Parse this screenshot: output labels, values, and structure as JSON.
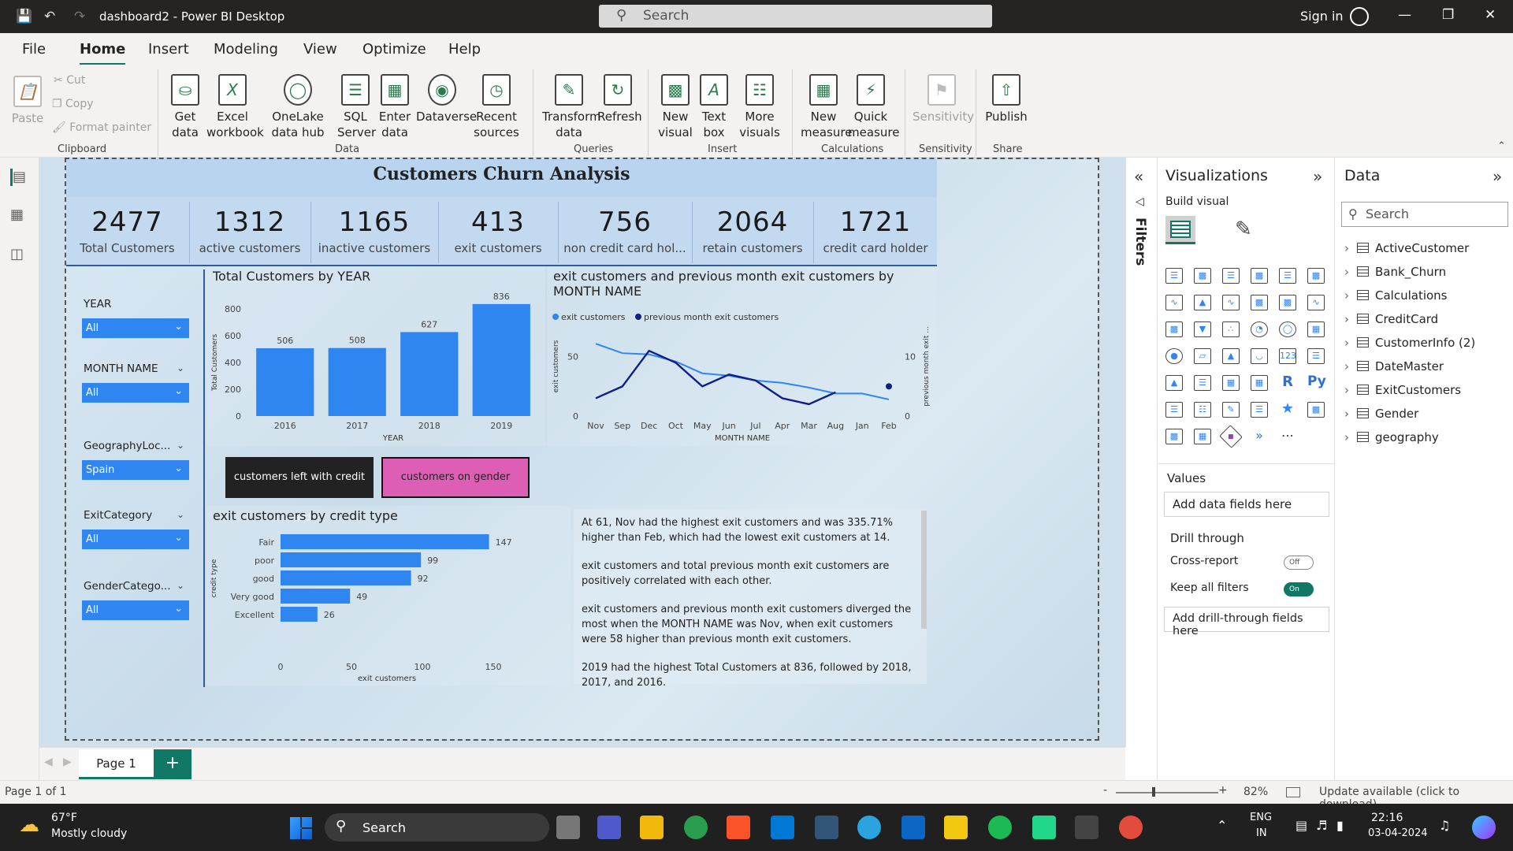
{
  "app": {
    "title": "dashboard2 - Power BI Desktop",
    "search": "Search",
    "signin": "Sign in"
  },
  "menu": [
    "File",
    "Home",
    "Insert",
    "Modeling",
    "View",
    "Optimize",
    "Help"
  ],
  "ribbon": {
    "clipboard": {
      "paste": "Paste",
      "cut": "Cut",
      "copy": "Copy",
      "format_painter": "Format painter",
      "group": "Clipboard"
    },
    "data": {
      "get_data": "Get data",
      "excel": "Excel workbook",
      "onelake": "OneLake data hub",
      "sql": "SQL Server",
      "enter": "Enter data",
      "dataverse": "Dataverse",
      "recent": "Recent sources",
      "group": "Data"
    },
    "queries": {
      "transform": "Transform data",
      "refresh": "Refresh",
      "group": "Queries"
    },
    "insert": {
      "new_visual": "New visual",
      "text_box": "Text box",
      "more_visuals": "More visuals",
      "group": "Insert"
    },
    "calc": {
      "new_measure": "New measure",
      "quick_measure": "Quick measure",
      "group": "Calculations"
    },
    "sensitivity": {
      "label": "Sensitivity",
      "group": "Sensitivity"
    },
    "share": {
      "publish": "Publish",
      "group": "Share"
    }
  },
  "report": {
    "title": "Customers Churn Analysis",
    "kpis": [
      {
        "value": "2477",
        "label": "Total Customers"
      },
      {
        "value": "1312",
        "label": "active customers"
      },
      {
        "value": "1165",
        "label": "inactive customers"
      },
      {
        "value": "413",
        "label": "exit customers"
      },
      {
        "value": "756",
        "label": "non credit card hol..."
      },
      {
        "value": "2064",
        "label": "retain customers"
      },
      {
        "value": "1721",
        "label": "credit card holder"
      }
    ],
    "slicers": [
      {
        "label": "YEAR",
        "value": "All"
      },
      {
        "label": "MONTH NAME",
        "value": "All"
      },
      {
        "label": "GeographyLoc...",
        "value": "Spain"
      },
      {
        "label": "ExitCategory",
        "value": "All"
      },
      {
        "label": "GenderCatego...",
        "value": "All"
      }
    ],
    "buttons": {
      "credit": "customers left with credit card",
      "gender": "customers on gender"
    },
    "narrative": {
      "p1": "At 61, Nov had the highest exit customers and was 335.71% higher than Feb, which had the lowest exit customers at 14.",
      "p2": "exit customers and total previous month exit customers are positively correlated with each other.",
      "p3": "exit customers and previous month exit customers diverged the most when the MONTH NAME was Nov, when exit customers were 58 higher than previous month exit customers.",
      "p4": "2019 had the highest Total Customers at 836, followed by 2018, 2017, and 2016."
    }
  },
  "chart_data": [
    {
      "type": "bar",
      "title": "Total Customers by YEAR",
      "xlabel": "YEAR",
      "ylabel": "Total Customers",
      "categories": [
        "2016",
        "2017",
        "2018",
        "2019"
      ],
      "values": [
        506,
        508,
        627,
        836
      ],
      "ylim": [
        0,
        800
      ],
      "yticks": [
        "0",
        "200",
        "400",
        "600",
        "800"
      ],
      "color": "#2f86f0"
    },
    {
      "type": "line",
      "title": "exit customers and previous month exit customers by MONTH NAME",
      "xlabel": "MONTH NAME",
      "ylabel": "exit customers",
      "y2label": "previous month exit ...",
      "categories": [
        "Nov",
        "Sep",
        "Dec",
        "Oct",
        "May",
        "Jun",
        "Jul",
        "Apr",
        "Mar",
        "Aug",
        "Jan",
        "Feb"
      ],
      "yticks": [
        "0",
        "50"
      ],
      "y2ticks": [
        "0",
        "10"
      ],
      "series": [
        {
          "name": "exit customers",
          "color": "#2f86f0",
          "values": [
            61,
            53,
            52,
            46,
            36,
            34,
            30,
            28,
            24,
            19,
            19,
            14
          ]
        },
        {
          "name": "previous month exit customers",
          "color": "#0e1f8a",
          "values": [
            3,
            5,
            11,
            9,
            5,
            7,
            6,
            3,
            2,
            4,
            null,
            5
          ]
        }
      ]
    },
    {
      "type": "bar",
      "orientation": "horizontal",
      "title": "exit customers by credit type",
      "xlabel": "exit customers",
      "ylabel": "credit type",
      "categories": [
        "Fair",
        "poor",
        "good",
        "Very good",
        "Excellent"
      ],
      "values": [
        147,
        99,
        92,
        49,
        26
      ],
      "xlim": [
        0,
        150
      ],
      "xticks": [
        "0",
        "50",
        "100",
        "150"
      ],
      "color": "#2f86f0"
    }
  ],
  "visualizations": {
    "title": "Visualizations",
    "build": "Build visual",
    "values": "Values",
    "add_data": "Add data fields here",
    "drill": "Drill through",
    "cross": "Cross-report",
    "cross_state": "Off",
    "keep": "Keep all filters",
    "keep_state": "On",
    "add_drill": "Add drill-through fields here",
    "filters": "Filters"
  },
  "data_pane": {
    "title": "Data",
    "search": "Search",
    "tables": [
      "ActiveCustomer",
      "Bank_Churn",
      "Calculations",
      "CreditCard",
      "CustomerInfo (2)",
      "DateMaster",
      "ExitCustomers",
      "Gender",
      "geography"
    ]
  },
  "pages": {
    "tab": "Page 1",
    "status": "Page 1 of 1",
    "zoom": "82%",
    "update": "Update available (click to download)"
  },
  "taskbar": {
    "temp": "67°F",
    "weather": "Mostly cloudy",
    "search": "Search",
    "lang1": "ENG",
    "lang2": "IN",
    "time": "22:16",
    "date": "03-04-2024"
  }
}
